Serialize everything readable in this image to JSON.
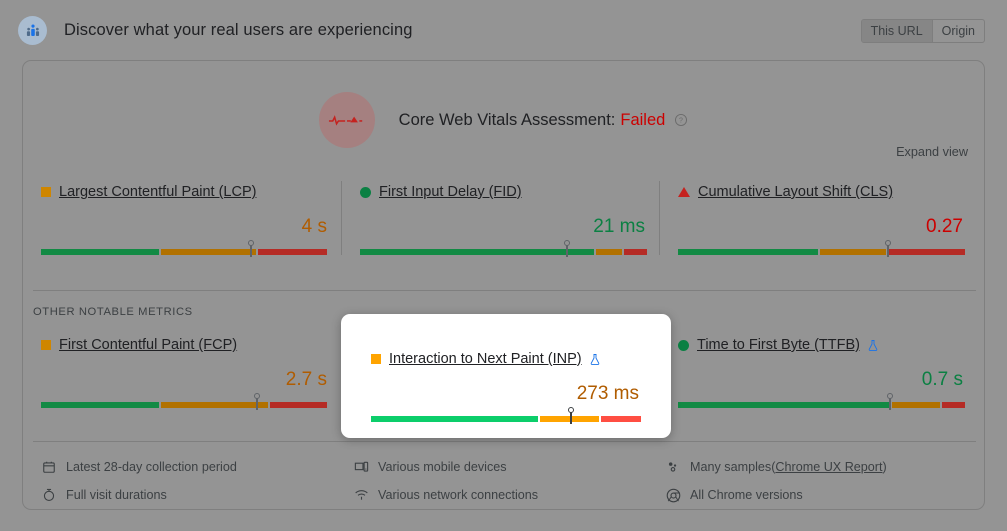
{
  "header": {
    "title": "Discover what your real users are experiencing",
    "logo_icon": "crux-users-icon",
    "toggle": {
      "options": [
        {
          "label": "This URL",
          "selected": true
        },
        {
          "label": "Origin",
          "selected": false
        }
      ]
    }
  },
  "assessment": {
    "badge_icon": "pulse-line-icon",
    "label": "Core Web Vitals Assessment:",
    "verdict": "Failed",
    "help_icon": "help-circle-icon",
    "verdict_color": "#cc0000"
  },
  "expand_view": {
    "label": "Expand view"
  },
  "other_metrics_label": "OTHER NOTABLE METRICS",
  "core_metrics": [
    {
      "icon": "square-amber-icon",
      "status": "average",
      "name": "Largest Contentful Paint (LCP)",
      "value": "4 s",
      "value_color": "#b05c00",
      "lab_icon": null,
      "gauge": {
        "green": 41,
        "amber": 34,
        "red": 25,
        "marker": 73
      }
    },
    {
      "icon": "circle-green-icon",
      "status": "good",
      "name": "First Input Delay (FID)",
      "value": "21 ms",
      "value_color": "#0b8043",
      "lab_icon": null,
      "gauge": {
        "green": 82,
        "amber": 9,
        "red": 9,
        "marker": 72
      }
    },
    {
      "icon": "triangle-red-icon",
      "status": "poor",
      "name": "Cumulative Layout Shift (CLS)",
      "value": "0.27",
      "value_color": "#cc0000",
      "lab_icon": null,
      "gauge": {
        "green": 49,
        "amber": 23,
        "red": 28,
        "marker": 73
      }
    }
  ],
  "other_notable_metrics": [
    {
      "icon": "square-amber-icon",
      "status": "average",
      "name": "First Contentful Paint (FCP)",
      "value": "2.7 s",
      "value_color": "#b05c00",
      "lab_icon": null,
      "gauge": {
        "green": 41,
        "amber": 38,
        "red": 21,
        "marker": 75
      }
    },
    {
      "icon": "square-amber-icon",
      "status": "average",
      "name": "Interaction to Next Paint (INP)",
      "value": "273 ms",
      "value_color": "#b05c00",
      "lab_icon": "flask-icon",
      "highlighted": true,
      "gauge": {
        "green": 62,
        "amber": 23,
        "red": 15,
        "marker": 74
      }
    },
    {
      "icon": "circle-green-icon",
      "status": "good",
      "name": "Time to First Byte (TTFB)",
      "value": "0.7 s",
      "value_color": "#0b8043",
      "lab_icon": "flask-icon",
      "gauge": {
        "green": 74,
        "amber": 17,
        "red": 9,
        "marker": 74
      }
    }
  ],
  "footer": {
    "columns": [
      [
        {
          "icon": "calendar-icon",
          "text": "Latest 28-day collection period"
        },
        {
          "icon": "timer-icon",
          "text": "Full visit durations"
        }
      ],
      [
        {
          "icon": "devices-icon",
          "text": "Various mobile devices"
        },
        {
          "icon": "wifi-icon",
          "text": "Various network connections"
        }
      ],
      [
        {
          "icon": "samples-icon",
          "text": "Many samples ",
          "link_text": "Chrome UX Report",
          "link_wrap": [
            "(",
            ")"
          ]
        },
        {
          "icon": "chrome-icon",
          "text": "All Chrome versions"
        }
      ]
    ]
  },
  "colors": {
    "good": "#0cce6b",
    "average": "#ffa400",
    "poor": "#ff4e42",
    "dim_background": "#949494",
    "failed_red": "#cc0000"
  }
}
